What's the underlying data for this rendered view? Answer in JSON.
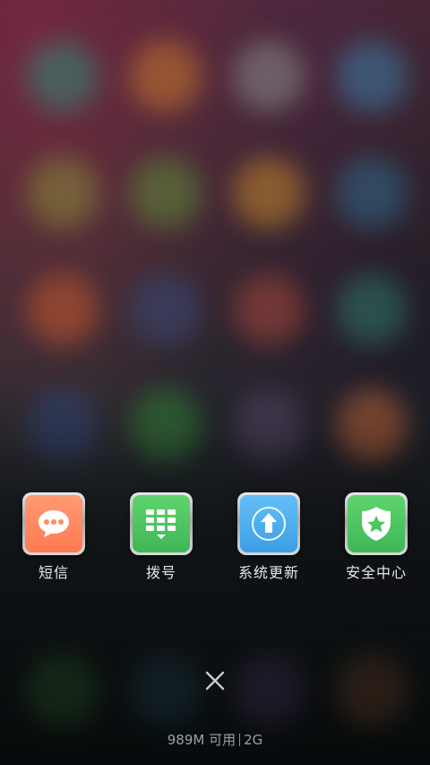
{
  "recent_apps": [
    {
      "label": "短信",
      "icon": "message-bubble-icon",
      "color": "#ff8a62"
    },
    {
      "label": "拨号",
      "icon": "dialpad-icon",
      "color": "#4cc45f"
    },
    {
      "label": "系统更新",
      "icon": "update-arrow-icon",
      "color": "#4caef0"
    },
    {
      "label": "安全中心",
      "icon": "shield-star-icon",
      "color": "#4cc45f"
    }
  ],
  "close_icon": "close-icon",
  "memory": {
    "available": "989M 可用",
    "total": "2G"
  }
}
